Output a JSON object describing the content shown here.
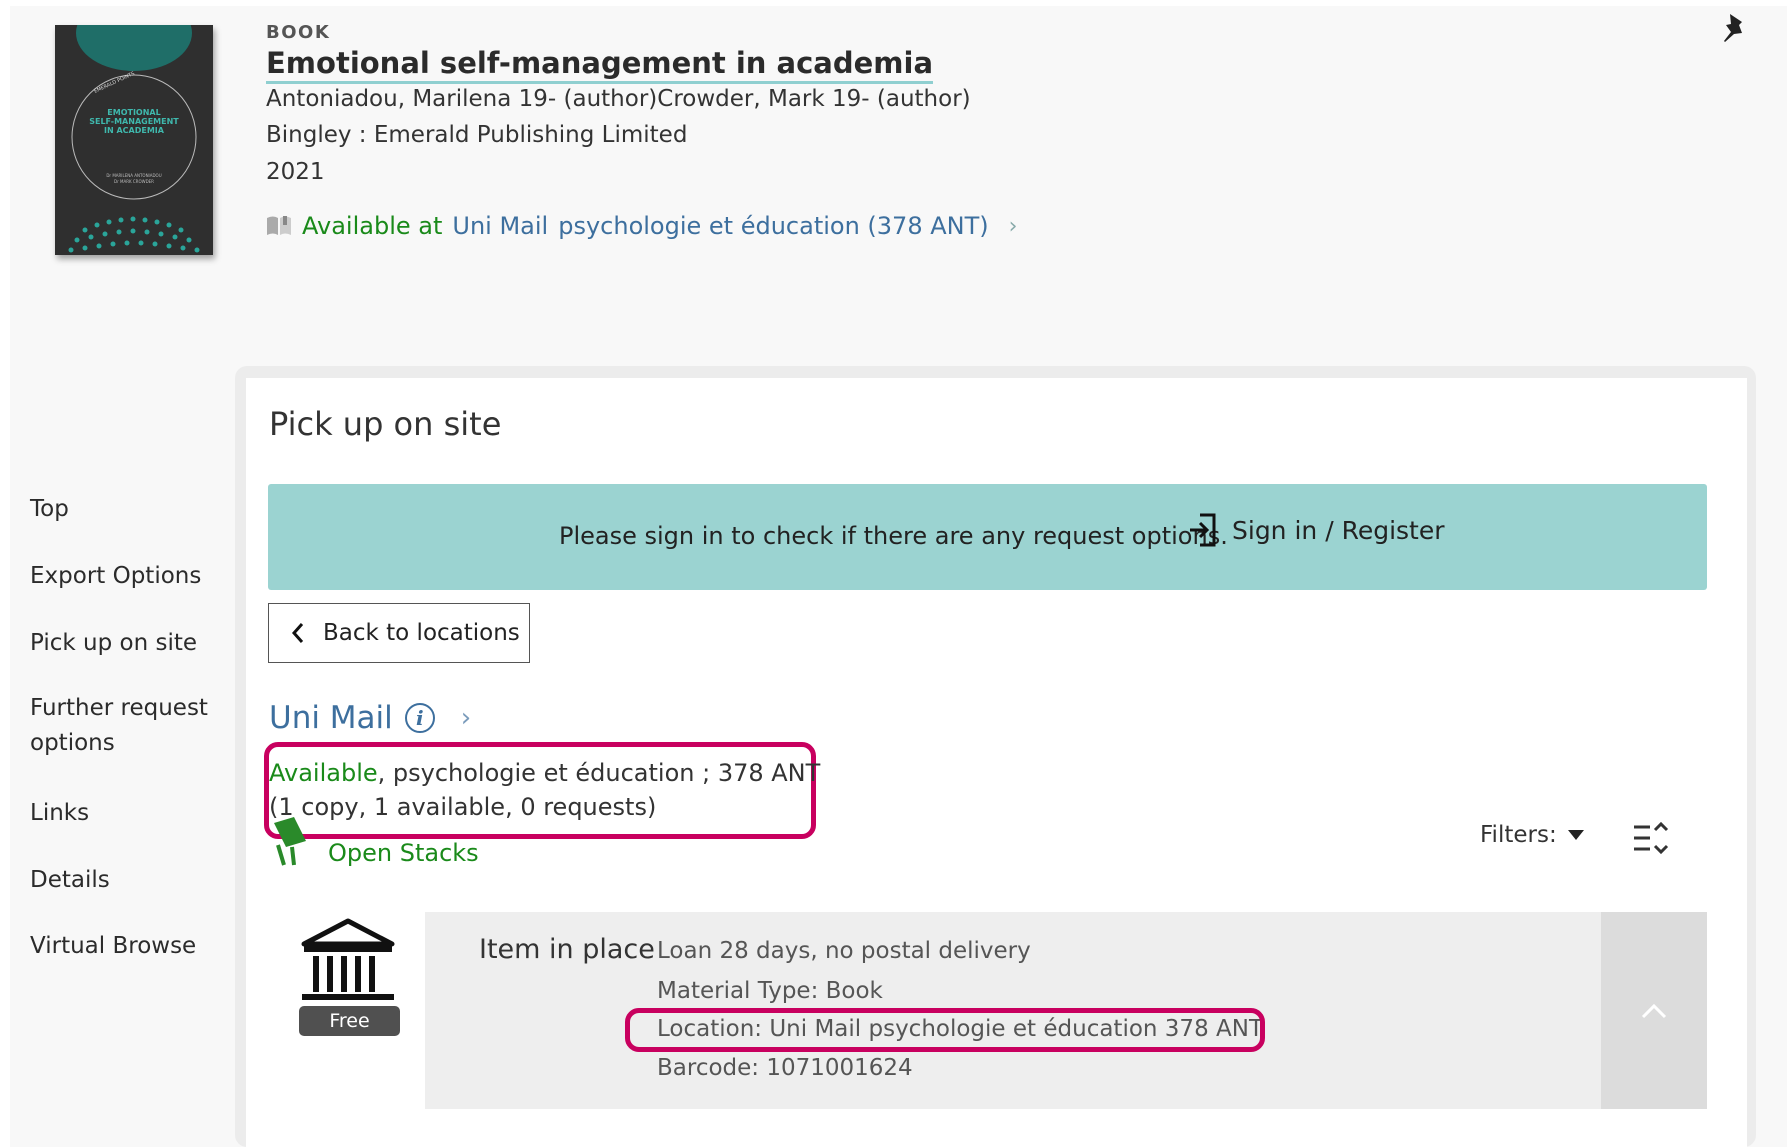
{
  "record": {
    "type": "BOOK",
    "title": "Emotional self-management in academia",
    "authors": "Antoniadou, Marilena 19- (author)Crowder, Mark 19- (author)",
    "publisher": "Bingley : Emerald Publishing Limited",
    "year": "2021",
    "availability_status": "Available at",
    "availability_library": "Uni Mail",
    "availability_location": "psychologie et éducation (378 ANT)",
    "cover": {
      "series": "EMERALD POINTS",
      "title_line1": "EMOTIONAL",
      "title_line2": "SELF-MANAGEMENT",
      "title_line3": "IN ACADEMIA",
      "authors_line1": "Dr MARILENA ANTONIADOU",
      "authors_line2": "Dr MARK CROWDER"
    }
  },
  "sidenav": {
    "items": [
      "Top",
      "Export Options",
      "Pick up on site",
      "Further request",
      "options",
      "Links",
      "Details",
      "Virtual Browse"
    ]
  },
  "pickup": {
    "title": "Pick up on site",
    "signin_message": "Please sign in to check if there are any request options.",
    "signin_label": "Sign in / Register",
    "back_label": "Back to locations",
    "location_name": "Uni Mail",
    "status": "Available",
    "status_detail": ", psychologie et éducation ; 378 ANT",
    "copies": "(1 copy, 1 available, 0 requests)",
    "stacks_label": "Open Stacks",
    "filters_label": "Filters:"
  },
  "item": {
    "badge": "Free",
    "status": "Item in place",
    "loan": "Loan 28 days, no postal delivery",
    "material": "Material Type: Book",
    "location": "Location: Uni Mail psychologie et éducation 378 ANT",
    "barcode": "Barcode: 1071001624"
  },
  "colors": {
    "accent_teal": "#9bd3d1",
    "available_green": "#1a8a1a",
    "link_blue": "#3d6f9e",
    "highlight_magenta": "#c8005f"
  }
}
